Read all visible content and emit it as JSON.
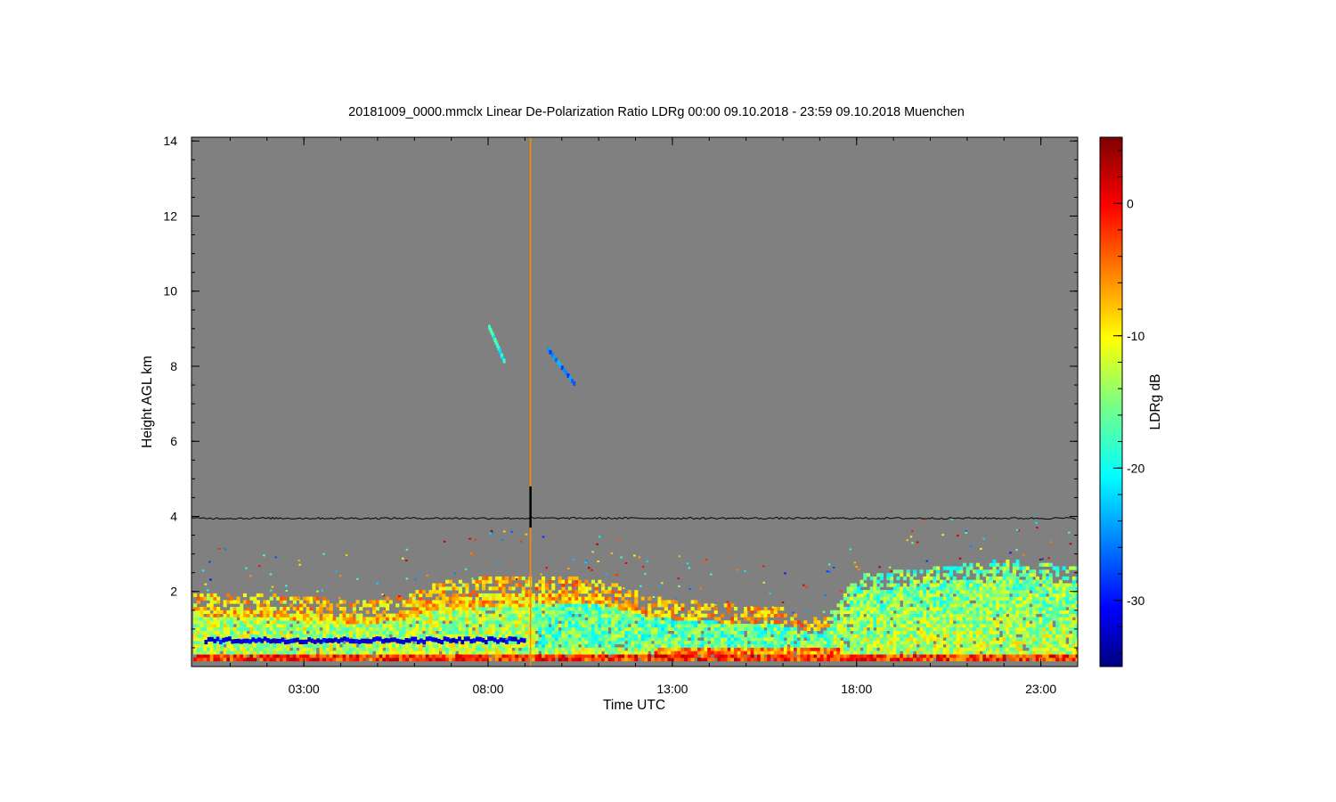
{
  "chart_data": {
    "type": "heatmap",
    "title": "20181009_0000.mmclx Linear De-Polarization Ratio LDRg   00:00 09.10.2018 - 23:59 09.10.2018 Muenchen",
    "xlabel": "Time UTC",
    "ylabel": "Height AGL km",
    "colorbar_label": "LDRg dB",
    "x_ticks": [
      {
        "hour": 3,
        "label": "03:00"
      },
      {
        "hour": 8,
        "label": "08:00"
      },
      {
        "hour": 13,
        "label": "13:00"
      },
      {
        "hour": 18,
        "label": "18:00"
      },
      {
        "hour": 23,
        "label": "23:00"
      }
    ],
    "y_ticks": [
      {
        "value": 2,
        "label": "2"
      },
      {
        "value": 4,
        "label": "4"
      },
      {
        "value": 6,
        "label": "6"
      },
      {
        "value": 8,
        "label": "8"
      },
      {
        "value": 10,
        "label": "10"
      },
      {
        "value": 12,
        "label": "12"
      },
      {
        "value": 14,
        "label": "14"
      }
    ],
    "colorbar_ticks": [
      {
        "value": 0,
        "label": "0"
      },
      {
        "value": -10,
        "label": "-10"
      },
      {
        "value": -20,
        "label": "-20"
      },
      {
        "value": -30,
        "label": "-30"
      }
    ],
    "xlim_hours": [
      -0.05,
      24.0
    ],
    "ylim_km": [
      0.0,
      14.1
    ],
    "clim_db": [
      -35,
      5
    ],
    "colormap": "jet",
    "background_color": "#808080",
    "reference_line_km": 3.95,
    "vertical_artifact_hour": 9.15,
    "features": [
      {
        "name": "boundary-layer echo",
        "start_hour": 0.0,
        "end_hour": 24.0,
        "bottom_km": 0.15,
        "top_km": 2.2,
        "ldr_db": [
          -22,
          -2
        ]
      },
      {
        "name": "low depolarization band",
        "start_hour": 0.3,
        "end_hour": 9.0,
        "height_km": 0.7,
        "ldr_db": -31
      },
      {
        "name": "cirrus fall streak",
        "start_hour": 8.0,
        "end_hour": 8.4,
        "bottom_km": 8.2,
        "top_km": 9.1,
        "ldr_db": -19
      },
      {
        "name": "cirrus fall streak",
        "start_hour": 9.6,
        "end_hour": 10.3,
        "bottom_km": 7.6,
        "top_km": 8.5,
        "ldr_db": -25
      }
    ]
  }
}
